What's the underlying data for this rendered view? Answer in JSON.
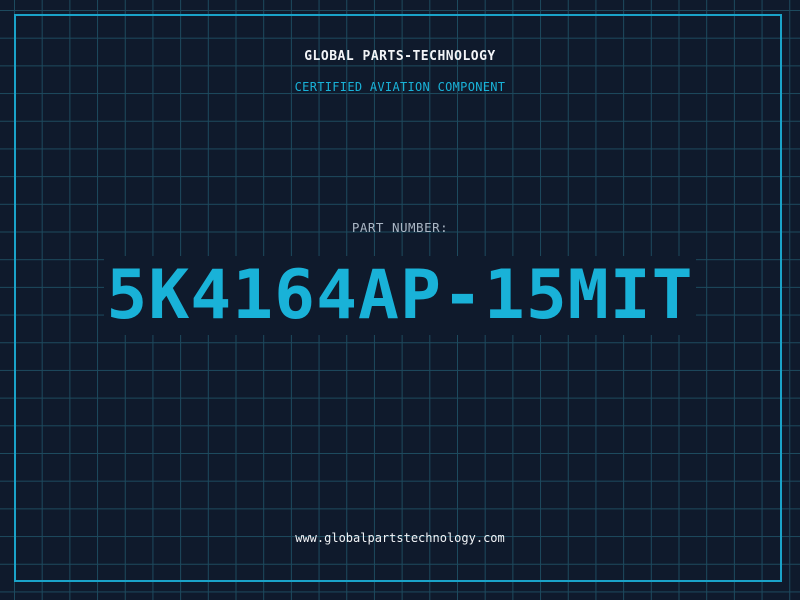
{
  "header": {
    "company": "GLOBAL PARTS-TECHNOLOGY",
    "tagline": "CERTIFIED AVIATION COMPONENT"
  },
  "part": {
    "label": "PART NUMBER:",
    "number": "5K4164AP-15MIT"
  },
  "footer": {
    "website": "www.globalpartstechnology.com"
  },
  "colors": {
    "background": "#0f1a2c",
    "grid": "#1d4a5e",
    "accent": "#19b2d8",
    "text": "#f2f4f7",
    "muted": "#aab6c4"
  }
}
